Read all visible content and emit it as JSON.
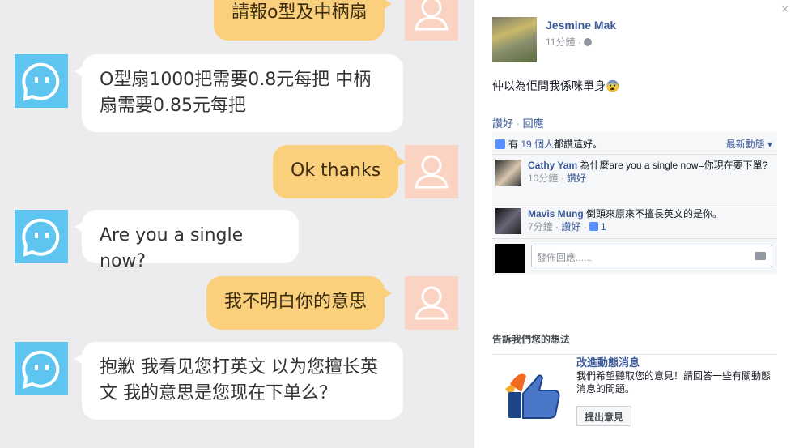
{
  "chat": {
    "messages": [
      {
        "from": "me",
        "text": "請報o型及中柄扇"
      },
      {
        "from": "bot",
        "text": "O型扇1000把需要0.8元每把   中柄扇需要0.85元每把"
      },
      {
        "from": "me",
        "text": "Ok thanks"
      },
      {
        "from": "bot",
        "text": "Are you a single now?"
      },
      {
        "from": "me",
        "text": "我不明白你的意思"
      },
      {
        "from": "bot",
        "text": "抱歉  我看见您打英文   以为您擅长英文   我的意思是您现在下单么？"
      }
    ]
  },
  "post": {
    "close_label": "×",
    "author": "Jesmine Mak",
    "time": "11分鐘 · ",
    "text": "仲以為佢問我係咪單身",
    "emoji": "😨",
    "actions": {
      "like": "讚好",
      "sep": " · ",
      "reply": "回應"
    }
  },
  "ufi": {
    "likes_prefix": "有 ",
    "likes_link": "19 個人",
    "likes_suffix": "都讚這好。",
    "sort_label": "最新動態",
    "comments": [
      {
        "name": "Cathy Yam",
        "text": "為什麼are you a single now=你現在要下單?",
        "time": "10分鐘",
        "sep": " · ",
        "like": "讚好",
        "likes": ""
      },
      {
        "name": "Mavis Mung",
        "text": "倒頭來原來不擅長英文的是你。",
        "time": "7分鐘",
        "sep": " · ",
        "like": "讚好",
        "likes": "1"
      }
    ],
    "reply_placeholder": "發佈回應......"
  },
  "feedback": {
    "title": "告訴我們您的想法",
    "heading": "改進動態消息",
    "description": "我們希望聽取您的意見！請回答一些有關動態消息的問題。",
    "button": "提出意見"
  },
  "colors": {
    "link": "#3b5998",
    "bot_avatar": "#5ec5f0",
    "me_bubble": "#fbd07c",
    "me_avatar": "#fbd3c2"
  },
  "icons": [
    "robot-face-icon",
    "user-silhouette-icon",
    "globe-icon",
    "thumbs-up-icon",
    "camera-icon",
    "close-icon",
    "caret-down-icon"
  ]
}
